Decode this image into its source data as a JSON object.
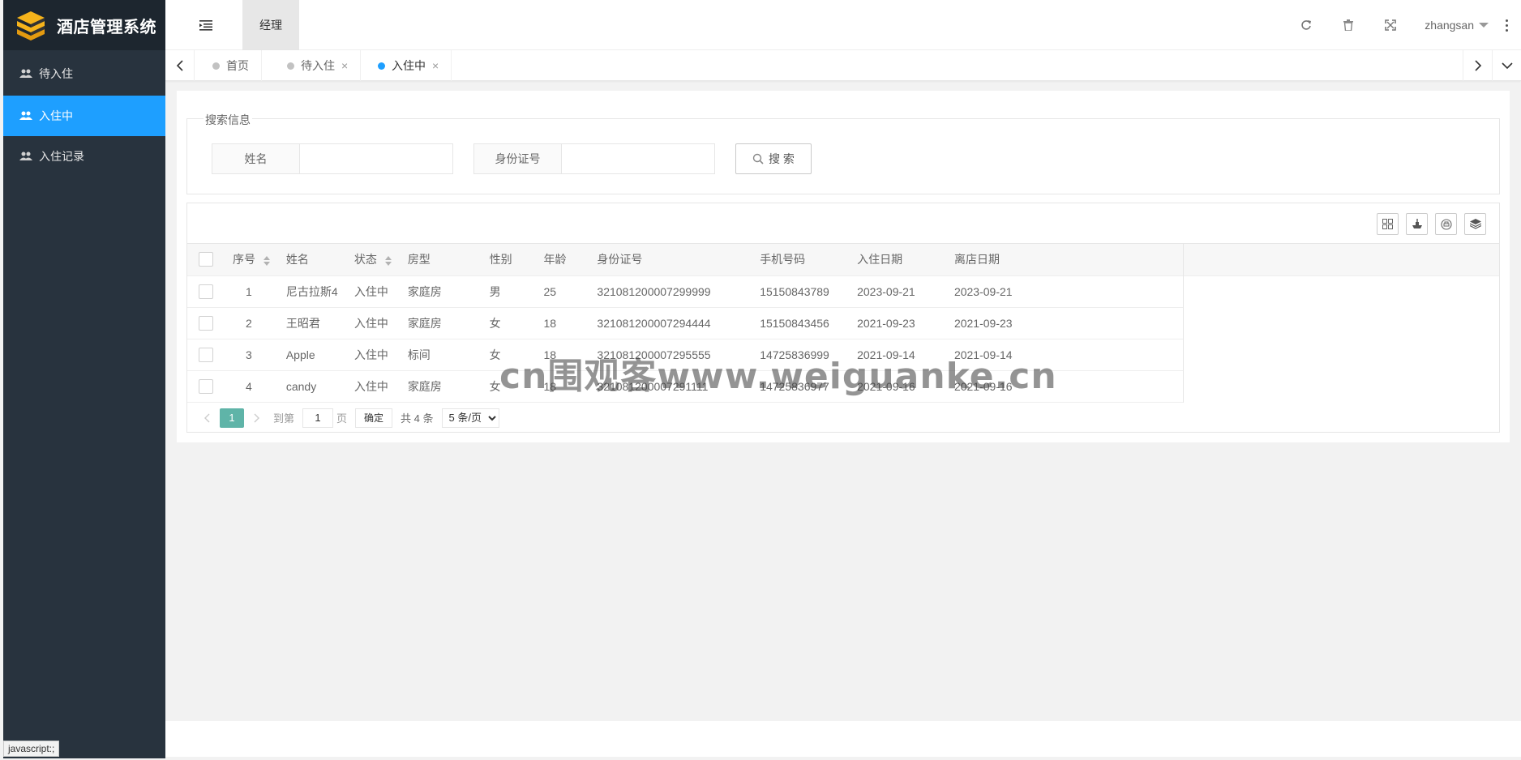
{
  "app": {
    "title": "酒店管理系统"
  },
  "sidebar": {
    "items": [
      {
        "label": "待入住",
        "icon": "users-icon",
        "active": false
      },
      {
        "label": "入住中",
        "icon": "users-icon",
        "active": true
      },
      {
        "label": "入住记录",
        "icon": "users-icon",
        "active": false
      }
    ]
  },
  "header": {
    "tab_label": "经理",
    "user": "zhangsan"
  },
  "tabs": [
    {
      "label": "首页"
    },
    {
      "label": "待入住",
      "close": "×"
    },
    {
      "label": "入住中",
      "close": "×"
    }
  ],
  "search": {
    "legend": "搜索信息",
    "name_label": "姓名",
    "id_label": "身份证号",
    "button_label": "搜 索"
  },
  "table": {
    "columns": [
      "序号",
      "姓名",
      "状态",
      "房型",
      "性别",
      "年龄",
      "身份证号",
      "手机号码",
      "入住日期",
      "离店日期"
    ],
    "rows": [
      [
        "1",
        "尼古拉斯4",
        "入住中",
        "家庭房",
        "男",
        "25",
        "321081200007299999",
        "15150843789",
        "2023-09-21",
        "2023-09-21"
      ],
      [
        "2",
        "王昭君",
        "入住中",
        "家庭房",
        "女",
        "18",
        "321081200007294444",
        "15150843456",
        "2021-09-23",
        "2021-09-23"
      ],
      [
        "3",
        "Apple",
        "入住中",
        "标间",
        "女",
        "18",
        "321081200007295555",
        "14725836999",
        "2021-09-14",
        "2021-09-14"
      ],
      [
        "4",
        "candy",
        "入住中",
        "家庭房",
        "女",
        "18",
        "321081200007291111",
        "14725836977",
        "2021-09-16",
        "2021-09-16"
      ]
    ]
  },
  "pager": {
    "current": "1",
    "skip_label": "到第",
    "page_input": "1",
    "page_unit": "页",
    "ok_label": "确定",
    "count_label": "共 4 条",
    "limit_label": "5 条/页"
  },
  "watermark": "cn围观客www.weiguanke.cn",
  "status_tip": "javascript:;",
  "colors": {
    "sidebar": "#28333e",
    "active": "#1e9fff",
    "pager_current": "#5fb4a8"
  }
}
